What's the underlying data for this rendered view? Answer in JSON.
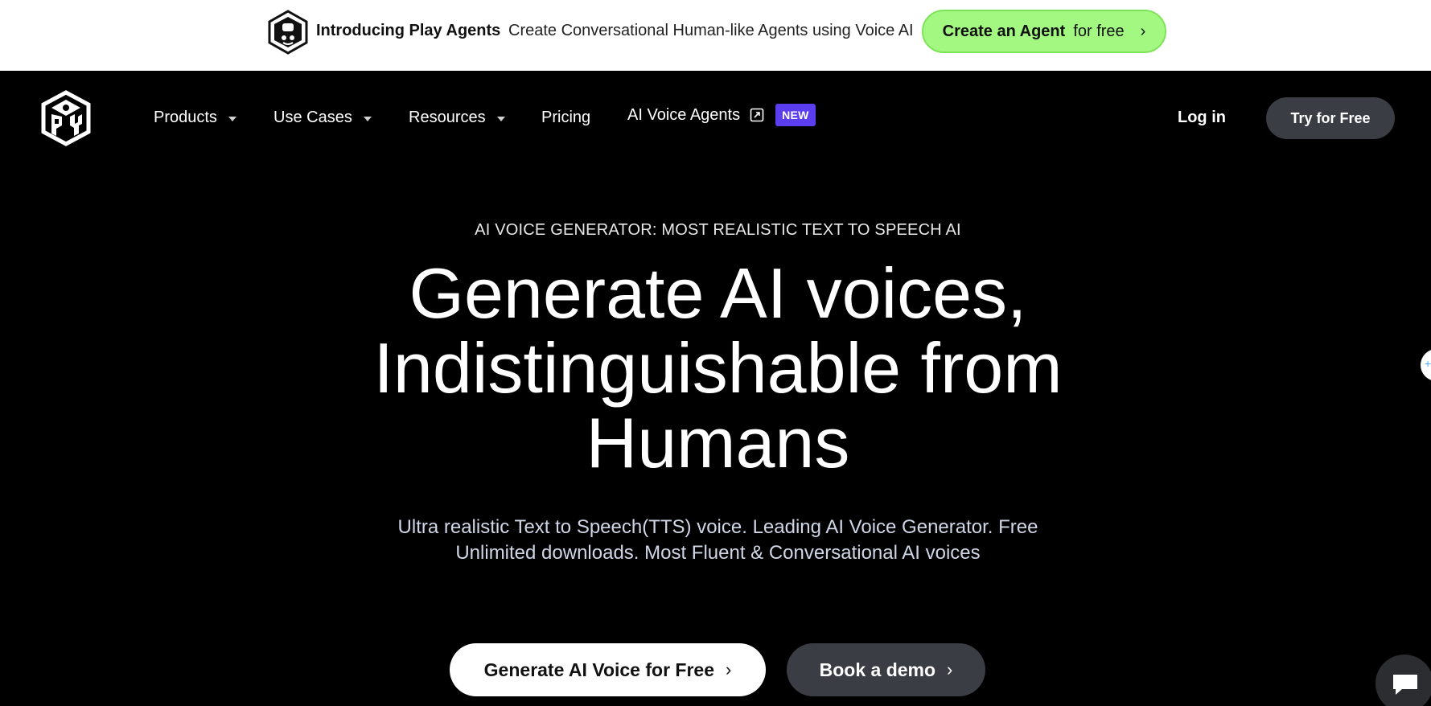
{
  "announcement": {
    "title": "Introducing Play Agents",
    "text": "Create Conversational Human-like Agents using Voice AI",
    "cta_strong": "Create an Agent",
    "cta_rest": "for free",
    "cta_chevron": "›",
    "logo_icon": "play-cube-logo"
  },
  "nav": {
    "logo_icon": "play-ht-logo",
    "items": [
      {
        "label": "Products",
        "dropdown": true
      },
      {
        "label": "Use Cases",
        "dropdown": true
      },
      {
        "label": "Resources",
        "dropdown": true
      },
      {
        "label": "Pricing",
        "dropdown": false
      },
      {
        "label": "AI Voice Agents",
        "external": true,
        "badge": "NEW"
      }
    ],
    "login": "Log in",
    "try_free": "Try for Free"
  },
  "hero": {
    "eyebrow": "AI VOICE GENERATOR: MOST REALISTIC TEXT TO SPEECH AI",
    "headline_line1": "Generate AI voices,",
    "headline_line2": "Indistinguishable from",
    "headline_line3": "Humans",
    "subtext_line1": "Ultra realistic Text to Speech(TTS) voice. Leading AI Voice Generator. Free",
    "subtext_line2": "Unlimited downloads. Most Fluent & Conversational AI voices",
    "primary_cta": "Generate AI Voice for Free",
    "secondary_cta": "Book a demo",
    "chevron": "›"
  },
  "colors": {
    "announce_cta_bg": "#a3f882",
    "badge_new": "#5b3ef0",
    "dark_button": "#3a3d44",
    "background": "#000000"
  }
}
